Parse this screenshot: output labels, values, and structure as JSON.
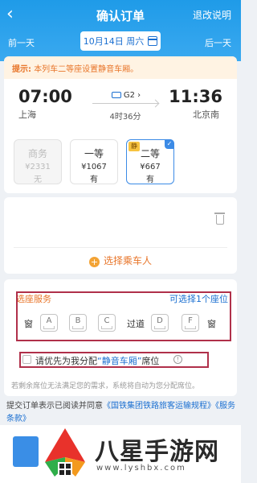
{
  "header": {
    "title": "确认订单",
    "refund_label": "退改说明",
    "prev_day": "前一天",
    "next_day": "后一天",
    "date": "10月14日 周六"
  },
  "trip": {
    "tip_prefix": "提示:",
    "tip_text": "本列车二等座设置静音车厢。",
    "depart_time": "07:00",
    "arrive_time": "11:36",
    "depart_station": "上海",
    "arrive_station": "北京南",
    "train_no": "G2",
    "duration": "4时36分",
    "seats": [
      {
        "name": "商务",
        "price": "¥2331",
        "avail": "无",
        "state": "disabled"
      },
      {
        "name": "一等",
        "price": "¥1067",
        "avail": "有",
        "state": "normal"
      },
      {
        "name": "二等",
        "price": "¥667",
        "avail": "有",
        "state": "selected",
        "badge": "静"
      }
    ]
  },
  "passenger": {
    "add_label": "选择乘车人"
  },
  "seat_selection": {
    "title": "选座服务",
    "hint": "可选择1个座位",
    "window_label": "窗",
    "aisle_label": "过道",
    "seats": [
      "A",
      "B",
      "C",
      "D",
      "F"
    ],
    "quiet_pre": "请优先为我分配",
    "quiet_highlight": "“静音车厢”",
    "quiet_post": "席位",
    "note": "若剩余席位无法满足您的需求，系统将自动为您分配席位。"
  },
  "terms": {
    "pre": "提交订单表示已阅读并同意",
    "link1": "《国铁集团铁路旅客运输规程》",
    "link2": "《服务条款》"
  },
  "watermark": {
    "text": "八星手游网",
    "url": "www.lyshbx.com"
  },
  "colors": {
    "primary": "#1f9be8",
    "accent": "#e8762b",
    "highlight_box": "#b0304a"
  }
}
